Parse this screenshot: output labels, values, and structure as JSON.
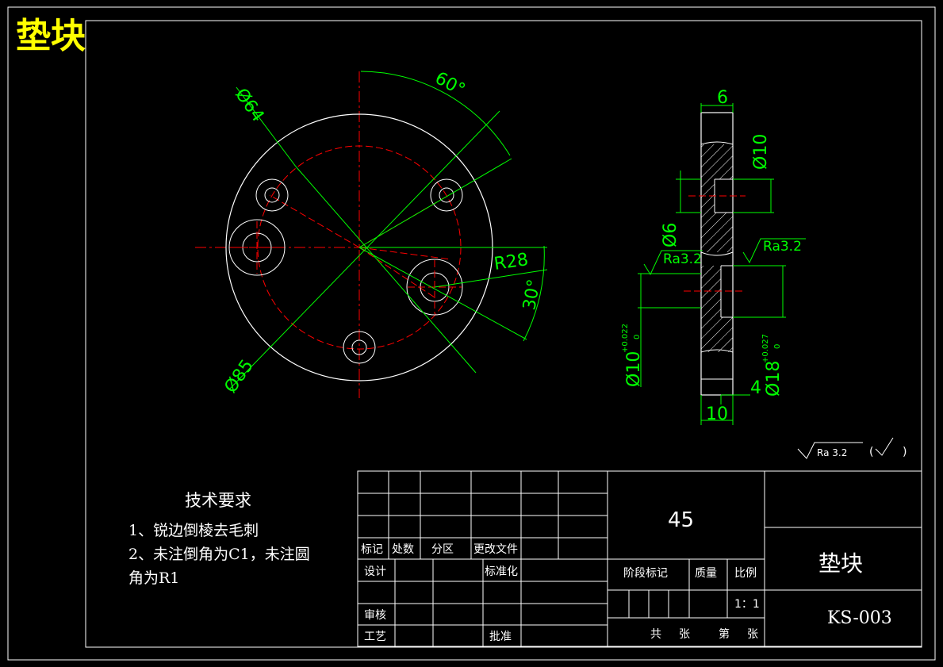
{
  "drawing_title": "垫块",
  "colors": {
    "background": "#000000",
    "outline": "#ffffff",
    "dimension": "#00ff00",
    "centerline": "#ff0000",
    "title": "#ffff00"
  },
  "dimensions": {
    "d64": "Ø64",
    "d85": "Ø85",
    "angle60": "60°",
    "angle30": "30°",
    "r28": "R28",
    "w6": "6",
    "d10": "Ø10",
    "d6": "Ø6",
    "ra_left": "Ra3.2",
    "ra_right": "Ra3.2",
    "d10tol_base": "Ø10",
    "d10tol_upper": "+0.022",
    "d10tol_lower": "0",
    "d18tol_base": "Ø18",
    "d18tol_upper": "+0.027",
    "d18tol_lower": "0",
    "w4": "4",
    "w10": "10"
  },
  "surface_note": {
    "ra": "Ra 3.2",
    "paren_open": "(",
    "paren_close": ")"
  },
  "tech_requirements": {
    "heading": "技术要求",
    "line1": "1、锐边倒棱去毛刺",
    "line2": "2、未注倒角为C1，未注圆",
    "line3": "角为R1"
  },
  "title_block": {
    "material": "45",
    "part_name": "垫块",
    "drawing_no": "KS-003",
    "mark": "标记",
    "count": "处数",
    "zone": "分区",
    "change_doc": "更改文件",
    "design": "设计",
    "standardize": "标准化",
    "stage_mark": "阶段标记",
    "weight": "质量",
    "scale_label": "比例",
    "scale_value": "1：1",
    "review": "审核",
    "process": "工艺",
    "approve": "批准",
    "total": "共",
    "sheets1": "张",
    "nth": "第",
    "sheets2": "张"
  }
}
